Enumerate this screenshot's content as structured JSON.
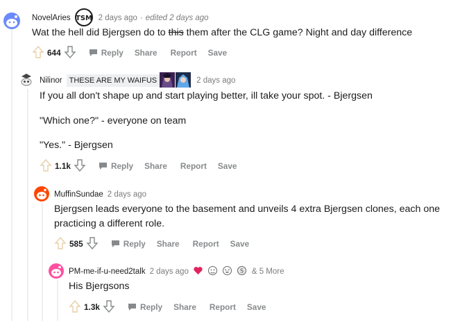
{
  "comments": [
    {
      "username": "NovelAries",
      "time": "2 days ago",
      "separator": "·",
      "edited": "edited 2 days ago",
      "body_before": "Wat the hell did Bjergsen do to ",
      "body_strike": "this",
      "body_after": " them after the CLG game? Night and day difference",
      "score": "644"
    },
    {
      "username": "Nilinor",
      "flair": "THESE ARE MY WAIFUS",
      "time": "2 days ago",
      "paragraphs": [
        "If you all don't shape up and start playing better, ill take your spot. - Bjergsen",
        "\"Which one?\" - everyone on team",
        "\"Yes.\" - Bjergsen"
      ],
      "score": "1.1k"
    },
    {
      "username": "MuffinSundae",
      "time": "2 days ago",
      "body_line1": "Bjergsen leads everyone to the basement and unveils 4 extra Bjergsen clones, each one",
      "body_line2": "practicing a different role.",
      "score": "585"
    },
    {
      "username": "PM-me-if-u-need2talk",
      "time": "2 days ago",
      "more_awards": "& 5 More",
      "body": "His Bjergsons",
      "score": "1.3k"
    }
  ],
  "actions": {
    "reply": "Reply",
    "share": "Share",
    "report": "Report",
    "save": "Save"
  },
  "colors": {
    "meta_gray": "#7c7c7c",
    "action_gray": "#878a8c",
    "flair_bg": "#edeff1",
    "snoo_blue": "#6b8afd",
    "snoo_red": "#ff4500"
  }
}
